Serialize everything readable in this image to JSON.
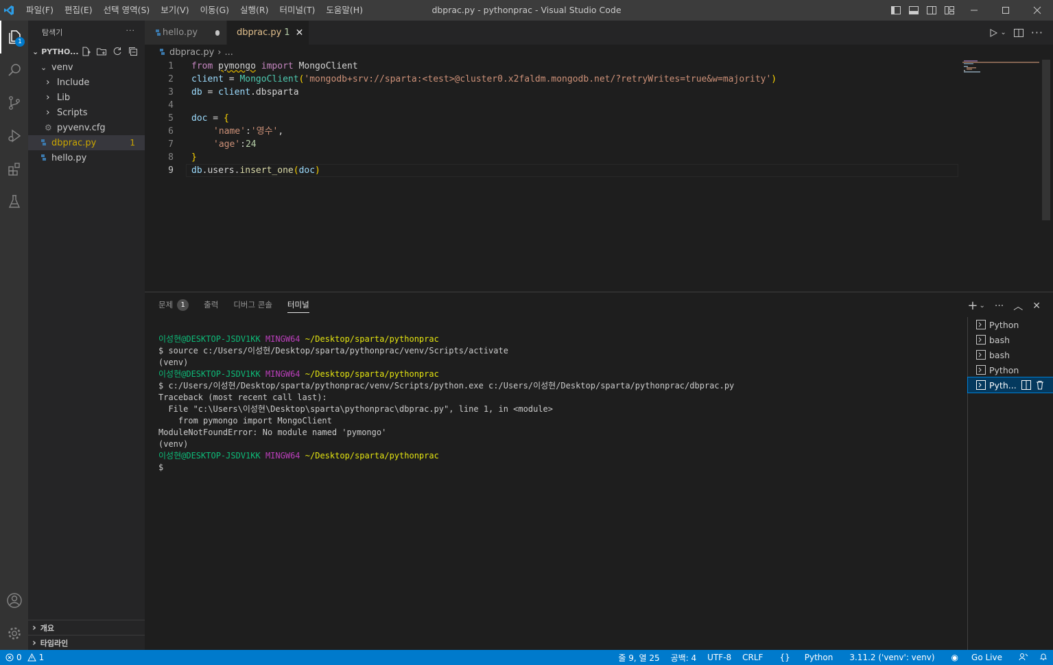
{
  "menu": [
    "파일(F)",
    "편집(E)",
    "선택 영역(S)",
    "보기(V)",
    "이동(G)",
    "실행(R)",
    "터미널(T)",
    "도움말(H)"
  ],
  "window_title": "dbprac.py - pythonprac - Visual Studio Code",
  "activity": {
    "explorer_badge": "1"
  },
  "explorer": {
    "title": "탐색기",
    "more": "···",
    "folder": "PYTHO...",
    "items": [
      {
        "label": "venv",
        "chevron": "⌄"
      },
      {
        "label": "Include",
        "chevron": "›"
      },
      {
        "label": "Lib",
        "chevron": "›"
      },
      {
        "label": "Scripts",
        "chevron": "›"
      },
      {
        "label": "pyvenv.cfg"
      },
      {
        "label": "dbprac.py",
        "count": "1"
      },
      {
        "label": "hello.py"
      }
    ],
    "outline": "개요",
    "timeline": "타임라인"
  },
  "tabs": [
    {
      "label": "hello.py"
    },
    {
      "label": "dbprac.py",
      "num": "1",
      "close": "✕"
    }
  ],
  "breadcrumb": {
    "file": "dbprac.py",
    "sep": "›",
    "rest": "..."
  },
  "editor": {
    "line_numbers": [
      "1",
      "2",
      "3",
      "4",
      "5",
      "6",
      "7",
      "8",
      "9"
    ],
    "tokens": {
      "from": "from",
      "pymongo": "pymongo",
      "import": "import",
      "MongoClient": "MongoClient",
      "client": "client",
      "eq": " = ",
      "MongoClient2": "MongoClient",
      "uri": "'mongodb+srv://sparta:<test>@cluster0.x2faldm.mongodb.net/?retryWrites=true&w=majority'",
      "db": "db",
      "client_ref": "client",
      "dbsparta": ".dbsparta",
      "doc": "doc",
      "brace_open": "{",
      "name_key": "'name'",
      "colon": ":",
      "name_val": "'영수'",
      "comma": ",",
      "age_key": "'age'",
      "age_val": "24",
      "brace_close": "}",
      "db2": "db",
      "users": ".users.",
      "insert_one": "insert_one",
      "doc_arg": "doc",
      "paren_open": "(",
      "paren_close": ")"
    }
  },
  "panel": {
    "tabs": [
      {
        "label": "문제",
        "badge": "1"
      },
      {
        "label": "출력"
      },
      {
        "label": "디버그 콘솔"
      },
      {
        "label": "터미널"
      }
    ],
    "actions": {
      "add": "+",
      "more": "···",
      "max": "︿",
      "close": "✕"
    },
    "terminal": {
      "user": "이성현@DESKTOP-JSDV1KK",
      "env": "MINGW64",
      "cwd": "~/Desktop/sparta/pythonprac",
      "cmd1": "$ source c:/Users/이성현/Desktop/sparta/pythonprac/venv/Scripts/activate",
      "venv": "(venv)",
      "cmd2": "$ c:/Users/이성현/Desktop/sparta/pythonprac/venv/Scripts/python.exe c:/Users/이성현/Desktop/sparta/pythonprac/dbprac.py",
      "tb1": "Traceback (most recent call last):",
      "tb2": "  File \"c:\\Users\\이성현\\Desktop\\sparta\\pythonprac\\dbprac.py\", line 1, in <module>",
      "tb3": "    from pymongo import MongoClient",
      "tb4": "ModuleNotFoundError: No module named 'pymongo'",
      "prompt": "$"
    },
    "terminal_list": [
      "Python",
      "bash",
      "bash",
      "Python",
      "Pyth..."
    ]
  },
  "status": {
    "errors": "0",
    "warnings": "1",
    "position": "줄 9, 열 25",
    "spaces": "공백: 4",
    "encoding": "UTF-8",
    "eol": "CRLF",
    "language": "Python",
    "interpreter": "3.11.2 ('venv': venv)",
    "golive": "Go Live"
  },
  "colors": {
    "accent": "#007acc",
    "titlebar": "#3c3c3c",
    "sidebar": "#252526",
    "editor": "#1e1e1e"
  }
}
